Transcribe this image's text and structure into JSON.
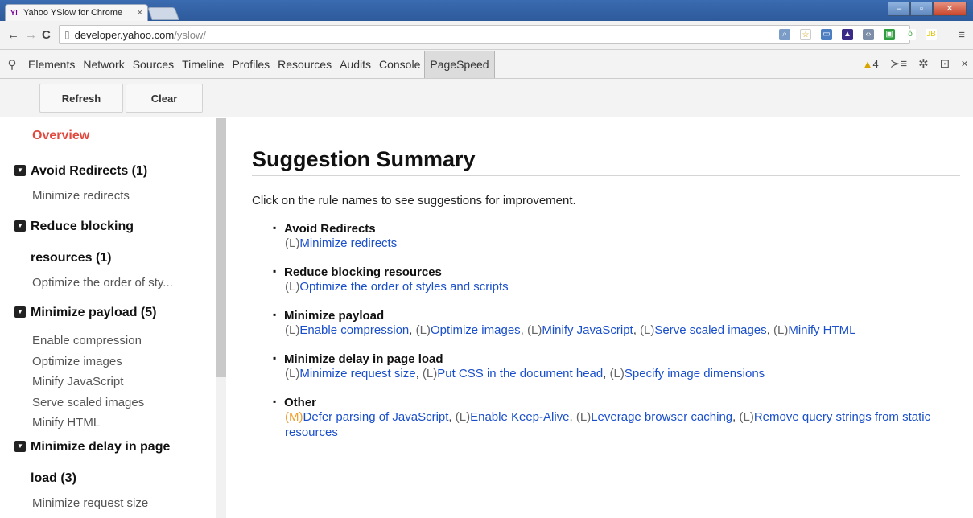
{
  "browser": {
    "tab_title": "Yahoo YSlow for Chrome",
    "tab_close": "×",
    "url_host": "developer.yahoo.com",
    "url_path": "/yslow/"
  },
  "devtools": {
    "tabs": [
      "Elements",
      "Network",
      "Sources",
      "Timeline",
      "Profiles",
      "Resources",
      "Audits",
      "Console",
      "PageSpeed"
    ],
    "active_tab": "PageSpeed",
    "warning_count": "4",
    "close": "×"
  },
  "actions": {
    "refresh_label": "Refresh",
    "clear_label": "Clear"
  },
  "sidebar": {
    "overview": "Overview",
    "groups": [
      {
        "title": "Avoid Redirects (1)",
        "items": [
          "Minimize redirects"
        ]
      },
      {
        "title": "Reduce blocking",
        "title2": "resources (1)",
        "items": [
          "Optimize the order of sty..."
        ]
      },
      {
        "title": "Minimize payload (5)",
        "items": [
          "Enable compression",
          "Optimize images",
          "Minify JavaScript",
          "Serve scaled images",
          "Minify HTML"
        ]
      },
      {
        "title": "Minimize delay in page",
        "title2": "load (3)",
        "items": [
          "Minimize request size"
        ]
      }
    ]
  },
  "main": {
    "heading": "Suggestion Summary",
    "intro": "Click on the rule names to see suggestions for improvement.",
    "rules": [
      {
        "title": "Avoid Redirects",
        "links": [
          {
            "level": "(L)",
            "text": "Minimize redirects"
          }
        ]
      },
      {
        "title": "Reduce blocking resources",
        "links": [
          {
            "level": "(L)",
            "text": "Optimize the order of styles and scripts"
          }
        ]
      },
      {
        "title": "Minimize payload",
        "links": [
          {
            "level": "(L)",
            "text": "Enable compression"
          },
          {
            "level": "(L)",
            "text": "Optimize images"
          },
          {
            "level": "(L)",
            "text": "Minify JavaScript"
          },
          {
            "level": "(L)",
            "text": "Serve scaled images"
          },
          {
            "level": "(L)",
            "text": "Minify HTML"
          }
        ]
      },
      {
        "title": "Minimize delay in page load",
        "links": [
          {
            "level": "(L)",
            "text": "Minimize request size"
          },
          {
            "level": "(L)",
            "text": "Put CSS in the document head"
          },
          {
            "level": "(L)",
            "text": "Specify image dimensions"
          }
        ]
      },
      {
        "title": "Other",
        "links": [
          {
            "level": "(M)",
            "text": "Defer parsing of JavaScript"
          },
          {
            "level": "(L)",
            "text": "Enable Keep-Alive"
          },
          {
            "level": "(L)",
            "text": "Leverage browser caching"
          },
          {
            "level": "(L)",
            "text": "Remove query strings from static resources"
          }
        ]
      }
    ]
  },
  "colors": {
    "overview_red": "#e04a3f",
    "link_blue": "#1a4fcc",
    "medium_orange": "#f0a030"
  }
}
